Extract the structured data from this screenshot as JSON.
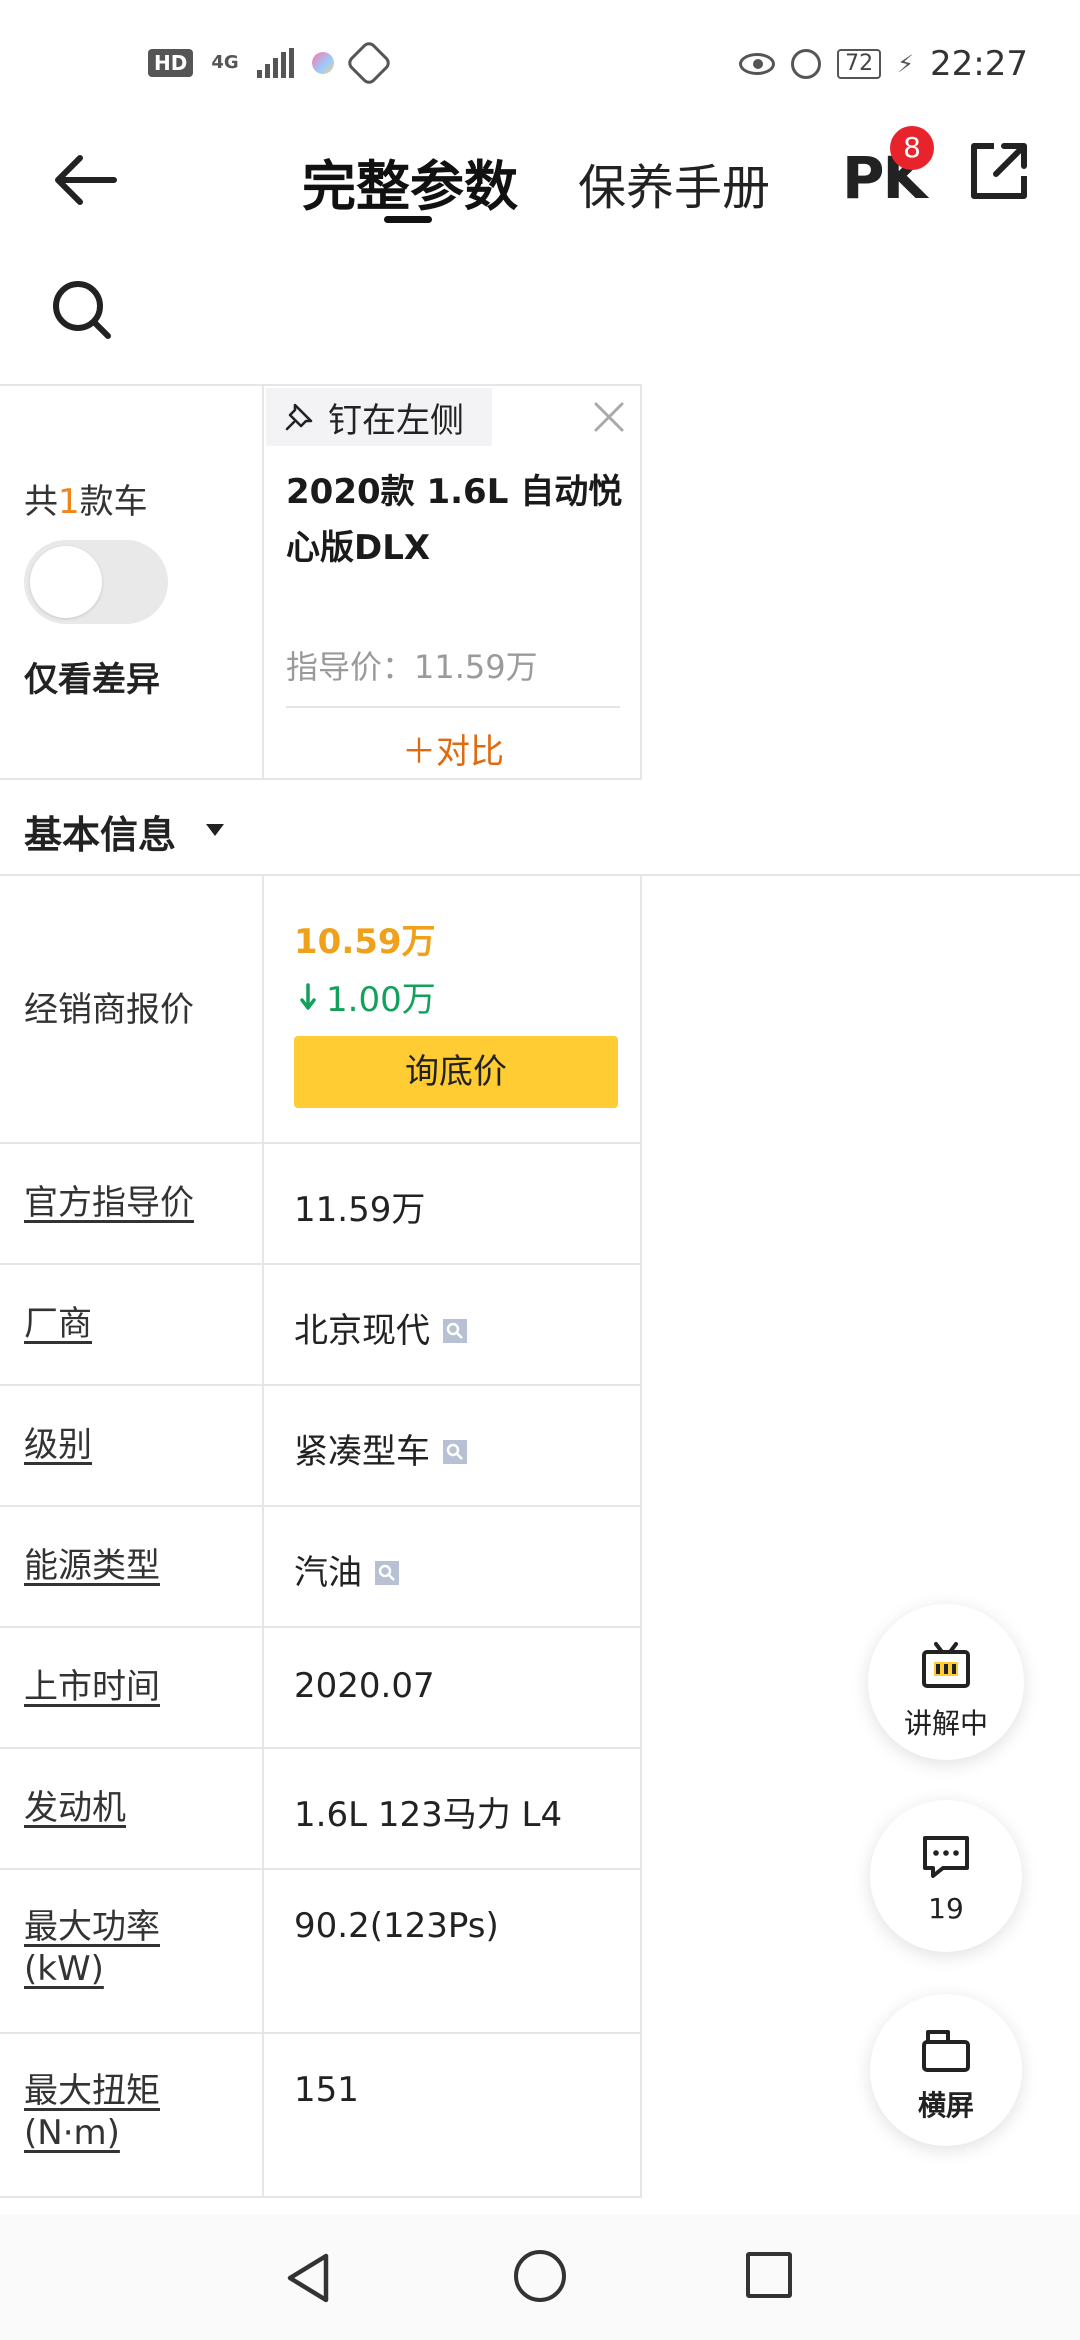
{
  "status_bar": {
    "hd": "HD",
    "network": "4G",
    "battery": "72",
    "time": "22:27"
  },
  "header": {
    "tabs": [
      {
        "label": "完整参数",
        "active": true
      },
      {
        "label": "保养手册",
        "active": false
      }
    ],
    "pk_label": "PK",
    "pk_badge": "8"
  },
  "car_header": {
    "total_prefix": "共",
    "total_count": "1",
    "total_suffix": "款车",
    "diff_toggle_label": "仅看差异",
    "diff_toggle_on": false,
    "pin_label": "钉在左侧",
    "car_name": "2020款 1.6L 自动悦心版DLX",
    "guide_price": "指导价：11.59万",
    "compare_label": "＋对比"
  },
  "section": {
    "title": "基本信息"
  },
  "specs": {
    "dealer": {
      "label": "经销商报价",
      "price": "10.59万",
      "drop": "1.00万",
      "button": "询底价"
    },
    "rows": [
      {
        "label": "官方指导价",
        "value": "11.59万"
      },
      {
        "label": "厂商",
        "value": "北京现代"
      },
      {
        "label": "级别",
        "value": "紧凑型车"
      },
      {
        "label": "能源类型",
        "value": "汽油"
      },
      {
        "label": "上市时间",
        "value": "2020.07"
      },
      {
        "label": "发动机",
        "value": "1.6L 123马力 L4"
      },
      {
        "label": "最大功率(kW)",
        "value": "90.2(123Ps)"
      },
      {
        "label": "最大扭矩(N·m)",
        "value": "151"
      }
    ]
  },
  "fabs": {
    "live": "讲解中",
    "comments_count": "19",
    "landscape": "横屏"
  },
  "colors": {
    "orange": "#f0a11c",
    "green": "#13a05a",
    "yellow_button": "#ffcc33",
    "badge_red": "#e8232b",
    "compare_orange": "#e06a10"
  }
}
